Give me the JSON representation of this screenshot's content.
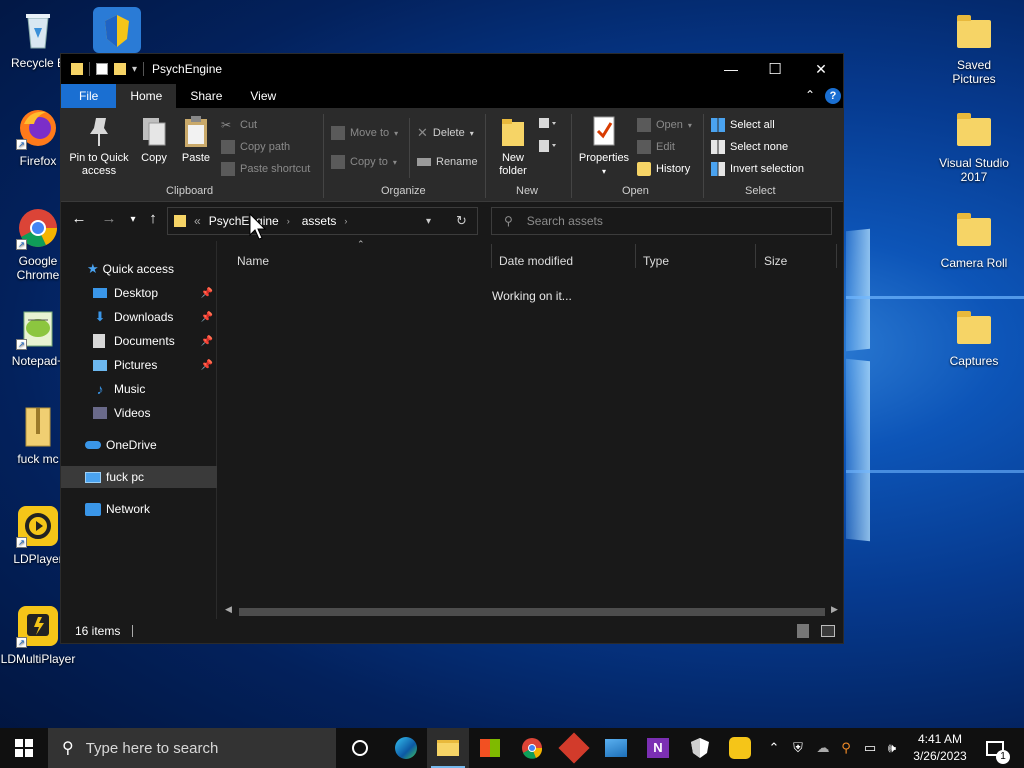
{
  "desktop": {
    "left_icons": [
      {
        "name": "recycle-bin",
        "label": "Recycle B"
      },
      {
        "name": "firefox",
        "label": "Firefox"
      },
      {
        "name": "google-chrome",
        "label": "Google Chrome"
      },
      {
        "name": "notepad-plus",
        "label": "Notepad+"
      },
      {
        "name": "zip-archive",
        "label": "fuck mc"
      },
      {
        "name": "ldplayer",
        "label": "LDPlayer"
      },
      {
        "name": "ldmultiplayer",
        "label": "LDMultiPlayer"
      }
    ],
    "right_icons": [
      {
        "name": "saved-pictures",
        "label": "Saved Pictures"
      },
      {
        "name": "visual-studio-2017",
        "label": "Visual Studio 2017"
      },
      {
        "name": "camera-roll",
        "label": "Camera Roll"
      },
      {
        "name": "captures",
        "label": "Captures"
      }
    ]
  },
  "window": {
    "title": "PsychEngine",
    "controls": {
      "minimize": "—",
      "maximize": "☐",
      "close": "✕"
    },
    "tabs": [
      "File",
      "Home",
      "Share",
      "View"
    ],
    "active_tab": "Home",
    "ribbon": {
      "clipboard": {
        "group_label": "Clipboard",
        "pin_line1": "Pin to Quick",
        "pin_line2": "access",
        "copy": "Copy",
        "paste": "Paste",
        "cut": "Cut",
        "copy_path": "Copy path",
        "paste_shortcut": "Paste shortcut"
      },
      "organize": {
        "group_label": "Organize",
        "move_to": "Move to",
        "copy_to": "Copy to",
        "delete": "Delete",
        "rename": "Rename"
      },
      "new": {
        "group_label": "New",
        "new_folder_line1": "New",
        "new_folder_line2": "folder"
      },
      "open": {
        "group_label": "Open",
        "properties": "Properties",
        "open": "Open",
        "edit": "Edit",
        "history": "History"
      },
      "select": {
        "group_label": "Select",
        "select_all": "Select all",
        "select_none": "Select none",
        "invert_selection": "Invert selection"
      }
    },
    "address": {
      "overflow": "«",
      "crumbs": [
        "PsychEngine",
        "assets"
      ]
    },
    "search_placeholder": "Search assets",
    "nav_pane": {
      "quick_access": "Quick access",
      "items": [
        {
          "label": "Desktop",
          "pinned": true
        },
        {
          "label": "Downloads",
          "pinned": true
        },
        {
          "label": "Documents",
          "pinned": true
        },
        {
          "label": "Pictures",
          "pinned": true
        },
        {
          "label": "Music",
          "pinned": false
        },
        {
          "label": "Videos",
          "pinned": false
        }
      ],
      "onedrive": "OneDrive",
      "this_pc": "fuck pc",
      "network": "Network"
    },
    "columns": [
      "Name",
      "Date modified",
      "Type",
      "Size"
    ],
    "content_status": "Working on it...",
    "status_bar": {
      "items": "16 items"
    }
  },
  "taskbar": {
    "search_placeholder": "Type here to search",
    "time": "4:41 AM",
    "date": "3/26/2023",
    "notification_count": "1"
  }
}
